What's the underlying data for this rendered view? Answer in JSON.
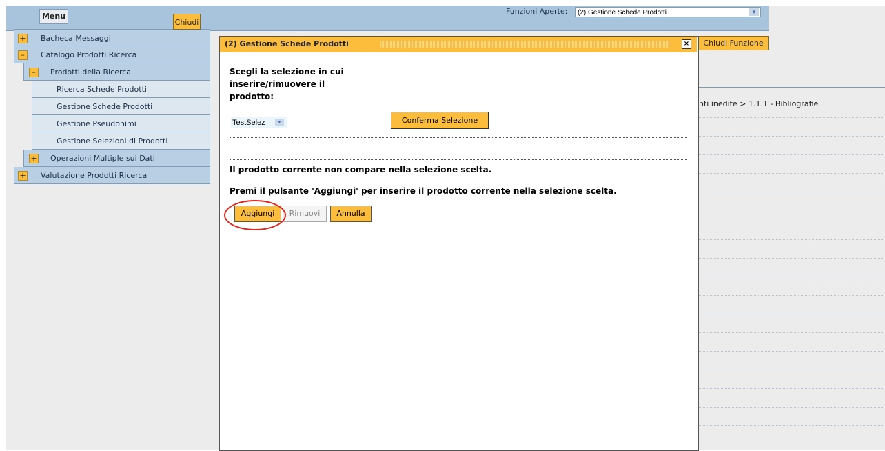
{
  "topbar": {
    "menu_label": "Menu",
    "funzioni_label": "Funzioni Aperte:",
    "funzioni_selected": "(2) Gestione Schede Prodotti",
    "chiudi_funzione_label": "Chiudi Funzione",
    "breadcrumb": "nti inedite > 1.1.1 - Bibliografie"
  },
  "menu": {
    "chiudi_label": "Chiudi",
    "items": [
      {
        "label": "Bacheca Messaggi",
        "toggle": "+"
      },
      {
        "label": "Catalogo Prodotti Ricerca",
        "toggle": "–"
      },
      {
        "label": "Prodotti della Ricerca",
        "toggle": "–"
      },
      {
        "label": "Ricerca Schede Prodotti"
      },
      {
        "label": "Gestione Schede Prodotti"
      },
      {
        "label": "Gestione Pseudonimi"
      },
      {
        "label": "Gestione Selezioni di Prodotti"
      },
      {
        "label": "Operazioni Multiple sui Dati",
        "toggle": "+"
      },
      {
        "label": "Valutazione Prodotti Ricerca",
        "toggle": "+"
      }
    ]
  },
  "dialog": {
    "title": "(2) Gestione Schede Prodotti",
    "close_glyph": "×",
    "prompt": "Scegli la selezione in cui inserire/rimuovere il prodotto:",
    "selection_value": "TestSelez",
    "conferma_label": "Conferma Selezione",
    "message1": "Il prodotto corrente non compare nella selezione scelta.",
    "message2": "Premi il pulsante 'Aggiungi' per inserire il prodotto corrente nella selezione scelta.",
    "buttons": {
      "aggiungi": "Aggiungi",
      "rimuovi": "Rimuovi",
      "annulla": "Annulla"
    }
  },
  "colors": {
    "accent": "#fcbc3c",
    "menu_bg": "#b9cfe3",
    "highlight": "#e0261c"
  },
  "icons": [
    "plus-icon",
    "minus-icon",
    "close-icon",
    "chevron-down-icon"
  ]
}
